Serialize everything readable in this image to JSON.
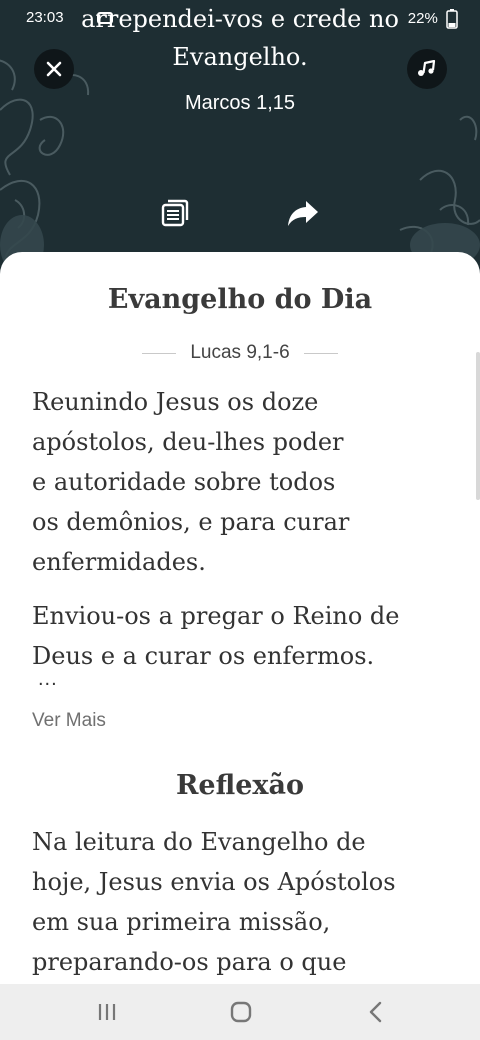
{
  "status_bar": {
    "time": "23:03",
    "battery": "22%"
  },
  "header": {
    "verse_line1": "arrependei-vos e crede no",
    "verse_line2": "Evangelho.",
    "verse_reference": "Marcos 1,15",
    "icons": [
      "close-icon",
      "audio-icon",
      "copy-icon",
      "share-icon"
    ]
  },
  "gospel": {
    "title": "Evangelho do Dia",
    "reference": "Lucas 9,1-6",
    "paragraph1_lines": [
      "Reunindo Jesus os doze",
      "apóstolos, deu-lhes poder",
      "e autoridade sobre todos",
      "os demônios, e para curar",
      "enfermidades."
    ],
    "paragraph2_lines": [
      "Enviou-os a pregar o Reino de",
      "Deus e a curar os enfermos."
    ],
    "ellipsis": "...",
    "see_more": "Ver Mais"
  },
  "reflection": {
    "title": "Reflexão",
    "lines": [
      "Na leitura do Evangelho de",
      "hoje, Jesus envia os Apóstolos",
      "em sua primeira missão,",
      "preparando-os para o que"
    ]
  },
  "colors": {
    "header_bg": "#1e2e33",
    "button_bg": "#0f1619",
    "text": "#333333",
    "muted": "#707070"
  }
}
